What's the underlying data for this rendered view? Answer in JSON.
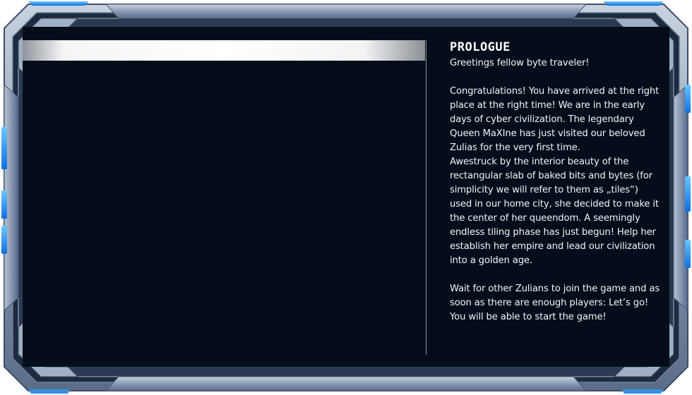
{
  "prologue": {
    "title": "Prologue",
    "greeting": "Greetings fellow byte traveler!",
    "paragraph_1": "Congratulations! You have arrived at the right place at the right time! We are in the early days of cyber civilization. The legendary Queen MaXIne has just visited our beloved Zulias for the very first time.",
    "paragraph_2": "Awestruck by the interior beauty of the rectangular slab of baked bits and bytes (for simplicity we will refer to them as „tiles“) used in our home city, she decided to make it the center of her queendom. A seemingly endless tiling phase has just begun! Help her establish her empire and lead our civilization into a golden age.",
    "paragraph_3": "Wait for other Zulians to join the game and as soon as there are enough players: Let’s go!",
    "paragraph_4": "You will be able to start the game!"
  },
  "colors": {
    "screen_background": "#050d1a",
    "frame_metal": "#8e9fb6",
    "frame_accent_blue": "#1e90ff",
    "text": "#f2f4f7"
  }
}
